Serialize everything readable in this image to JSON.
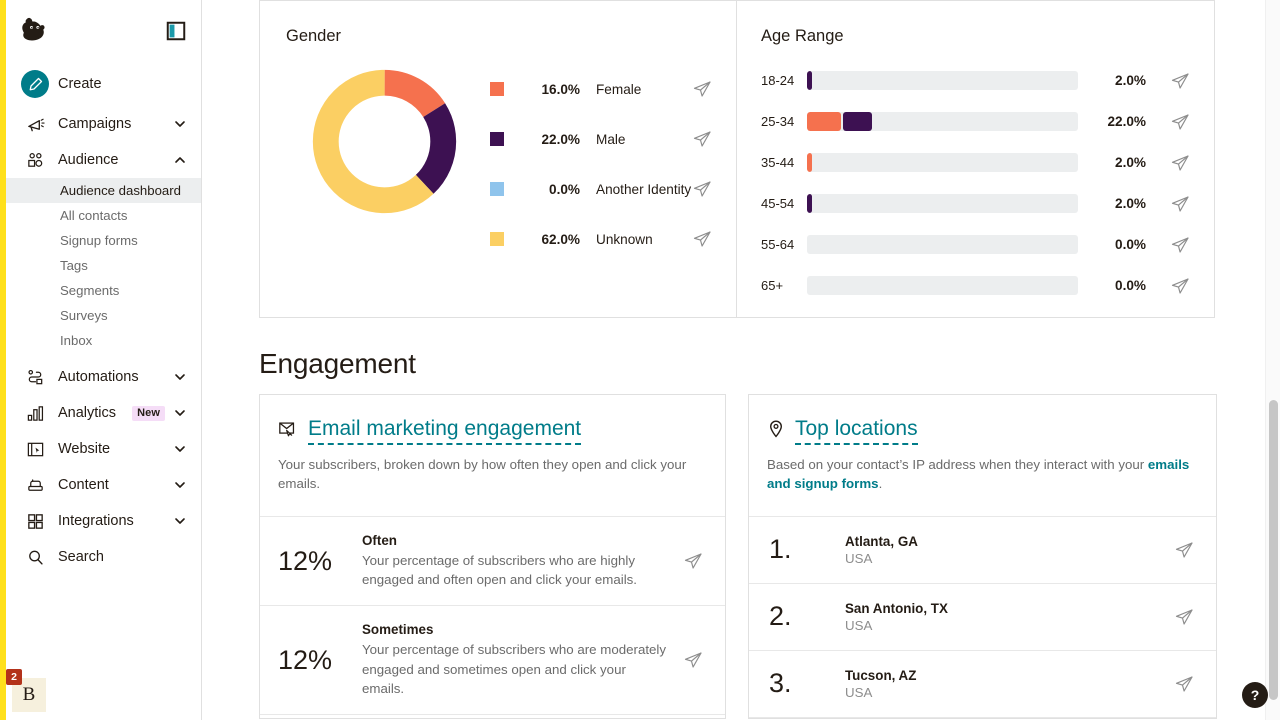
{
  "sidebar": {
    "logo": "freddie-logo",
    "toggle_icon": "panel-collapse-icon",
    "create_label": "Create",
    "items": [
      {
        "label": "Campaigns",
        "icon": "megaphone-icon",
        "expanded": false
      },
      {
        "label": "Audience",
        "icon": "audience-icon",
        "expanded": true
      },
      {
        "label": "Automations",
        "icon": "automations-icon",
        "expanded": false
      },
      {
        "label": "Analytics",
        "icon": "bar-chart-icon",
        "expanded": false,
        "badge": "New"
      },
      {
        "label": "Website",
        "icon": "website-icon",
        "expanded": false
      },
      {
        "label": "Content",
        "icon": "content-icon",
        "expanded": false
      },
      {
        "label": "Integrations",
        "icon": "grid-icon",
        "expanded": false
      },
      {
        "label": "Search",
        "icon": "search-icon",
        "expanded": false
      }
    ],
    "audience_subitems": [
      {
        "label": "Audience dashboard",
        "active": true
      },
      {
        "label": "All contacts",
        "active": false
      },
      {
        "label": "Signup forms",
        "active": false
      },
      {
        "label": "Tags",
        "active": false
      },
      {
        "label": "Segments",
        "active": false
      },
      {
        "label": "Surveys",
        "active": false
      },
      {
        "label": "Inbox",
        "active": false
      }
    ],
    "account": {
      "initial": "B",
      "badge_count": "2"
    }
  },
  "chart_data": [
    {
      "type": "pie",
      "title": "Gender",
      "categories": [
        "Female",
        "Male",
        "Another Identity",
        "Unknown"
      ],
      "values": [
        16.0,
        22.0,
        0.0,
        62.0
      ],
      "value_labels": [
        "16.0%",
        "22.0%",
        "0.0%",
        "62.0%"
      ],
      "colors": [
        "#F5714E",
        "#3D1152",
        "#8FC4EC",
        "#FBCF63"
      ],
      "legend": "right",
      "donut": true
    },
    {
      "type": "bar",
      "title": "Age Range",
      "orientation": "horizontal",
      "stacked": true,
      "categories": [
        "18-24",
        "25-34",
        "35-44",
        "45-54",
        "55-64",
        "65+"
      ],
      "values": [
        2.0,
        22.0,
        2.0,
        2.0,
        0.0,
        0.0
      ],
      "value_labels": [
        "2.0%",
        "22.0%",
        "2.0%",
        "2.0%",
        "0.0%",
        "0.0%"
      ],
      "series": [
        {
          "name": "Female",
          "color": "#F5714E",
          "values": [
            0.0,
            12.0,
            2.0,
            0.0,
            0.0,
            0.0
          ]
        },
        {
          "name": "Male",
          "color": "#3D1152",
          "values": [
            2.0,
            10.0,
            0.0,
            2.0,
            0.0,
            0.0
          ]
        }
      ],
      "xlim": [
        0,
        100
      ],
      "grid": false,
      "track_color": "#ECEEEF"
    }
  ],
  "engagement": {
    "section_title": "Engagement",
    "email": {
      "icon": "envelope-click-icon",
      "title": "Email marketing engagement",
      "description": "Your subscribers, broken down by how often they open and click your emails.",
      "rows": [
        {
          "percent": "12%",
          "name": "Often",
          "description": "Your percentage of subscribers who are highly engaged and often open and click your emails.",
          "send_icon": "send-icon"
        },
        {
          "percent": "12%",
          "name": "Sometimes",
          "description": "Your percentage of subscribers who are moderately engaged and sometimes open and click your emails.",
          "send_icon": "send-icon"
        }
      ]
    },
    "locations": {
      "icon": "location-pin-icon",
      "title": "Top locations",
      "description_prefix": "Based on your contact’s IP address when they interact with your ",
      "description_link": "emails and signup forms",
      "description_suffix": ".",
      "rows": [
        {
          "rank": "1.",
          "city": "Atlanta, GA",
          "country": "USA",
          "send_icon": "send-icon"
        },
        {
          "rank": "2.",
          "city": "San Antonio, TX",
          "country": "USA",
          "send_icon": "send-icon"
        },
        {
          "rank": "3.",
          "city": "Tucson, AZ",
          "country": "USA",
          "send_icon": "send-icon"
        }
      ]
    }
  },
  "help": {
    "label": "?"
  },
  "colors": {
    "brand_yellow": "#FFE01B",
    "teal": "#007C89",
    "female": "#F5714E",
    "male": "#3D1152",
    "another": "#8FC4EC",
    "unknown": "#FBCF63",
    "track": "#ECEEEF",
    "badge_red": "#B3321A",
    "badge_pink": "#F5DDF7"
  }
}
